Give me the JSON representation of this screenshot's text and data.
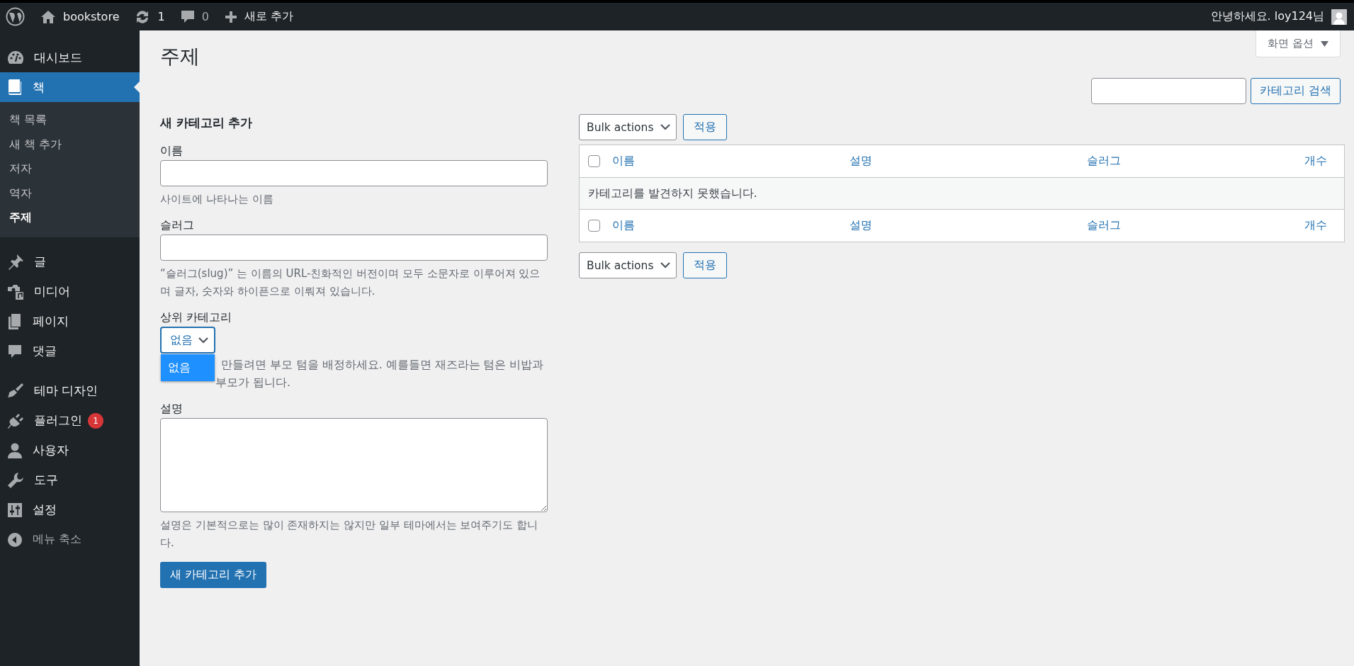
{
  "admin_bar": {
    "site_name": "bookstore",
    "updates_count": "1",
    "comments_count": "0",
    "new_label": "새로 추가",
    "greeting": "안녕하세요. loy124님"
  },
  "sidebar": {
    "items": [
      {
        "label": "대시보드",
        "selected": false
      },
      {
        "label": "책",
        "selected": true,
        "children": [
          {
            "label": "책 목록",
            "selected": false
          },
          {
            "label": "새 책 추가",
            "selected": false
          },
          {
            "label": "저자",
            "selected": false
          },
          {
            "label": "역자",
            "selected": false
          },
          {
            "label": "주제",
            "selected": true
          }
        ]
      },
      {
        "label": "글",
        "selected": false
      },
      {
        "label": "미디어",
        "selected": false
      },
      {
        "label": "페이지",
        "selected": false
      },
      {
        "label": "댓글",
        "selected": false
      },
      {
        "label": "테마 디자인",
        "selected": false
      },
      {
        "label": "플러그인",
        "selected": false,
        "badge": "1"
      },
      {
        "label": "사용자",
        "selected": false
      },
      {
        "label": "도구",
        "selected": false
      },
      {
        "label": "설정",
        "selected": false
      }
    ],
    "collapse_label": "메뉴 축소"
  },
  "page": {
    "title": "주제",
    "screen_options": "화면 옵션",
    "search_button": "카테고리 검색"
  },
  "form": {
    "heading": "새 카테고리 추가",
    "fields": [
      {
        "kind": "text",
        "label": "이름",
        "hint": "사이트에 나타나는 이름"
      },
      {
        "kind": "text",
        "label": "슬러그",
        "hint": "“슬러그(slug)” 는 이름의 URL-친화적인 버전이며 모두 소문자로 이루어져 있으며 글자, 숫자와 하이픈으로 이뤄져 있습니다."
      },
      {
        "kind": "select",
        "label": "상위 카테고리",
        "value": "없음",
        "open": true,
        "options": [
          {
            "label": "없음",
            "selected": true
          }
        ],
        "hint_parts": [
          "만들려면 부모 텀을 배정하세요. 예를들면 재즈라는 텀은 비밥과",
          "부모가 됩니다."
        ]
      },
      {
        "kind": "textarea",
        "label": "설명",
        "hint": "설명은 기본적으로는 많이 존재하지는 않지만 일부 테마에서는 보여주기도 합니다."
      }
    ],
    "submit": "새 카테고리 추가"
  },
  "table": {
    "bulk_top": {
      "label": "Bulk actions",
      "apply": "적용"
    },
    "header": {
      "checked": false,
      "columns": [
        "이름",
        "설명",
        "슬러그",
        "개수"
      ]
    },
    "empty_message": "카테고리를 발견하지 못했습니다.",
    "footer": {
      "checked": false,
      "columns": [
        "이름",
        "설명",
        "슬러그",
        "개수"
      ]
    },
    "bulk_bottom": {
      "label": "Bulk actions",
      "apply": "적용"
    }
  }
}
